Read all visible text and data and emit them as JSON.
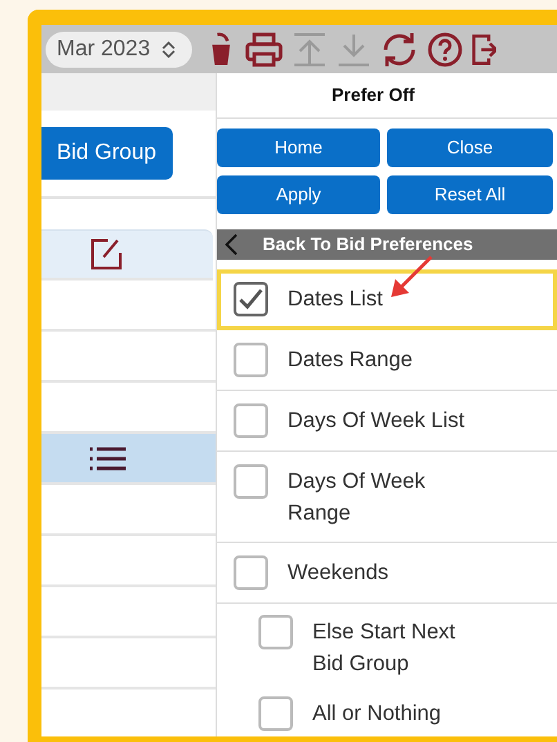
{
  "toolbar": {
    "period": "Mar 2023",
    "icons": [
      {
        "kind": "trash",
        "disabled": false
      },
      {
        "kind": "print",
        "disabled": false
      },
      {
        "kind": "upload",
        "disabled": true
      },
      {
        "kind": "download",
        "disabled": true
      },
      {
        "kind": "refresh",
        "disabled": false
      },
      {
        "kind": "help",
        "disabled": false
      },
      {
        "kind": "logout",
        "disabled": false
      }
    ]
  },
  "left_panel": {
    "button": "Bid Group",
    "rows": [
      {
        "kind": "edit",
        "selected": false
      },
      {
        "kind": "empty",
        "selected": false
      },
      {
        "kind": "empty",
        "selected": false
      },
      {
        "kind": "empty",
        "selected": false
      },
      {
        "kind": "list",
        "selected": true
      },
      {
        "kind": "empty",
        "selected": false
      },
      {
        "kind": "empty",
        "selected": false
      },
      {
        "kind": "empty",
        "selected": false
      },
      {
        "kind": "empty",
        "selected": false
      }
    ]
  },
  "right_panel": {
    "title": "Prefer Off",
    "buttons": [
      "Home",
      "Close",
      "Apply",
      "Reset All"
    ],
    "back": "Back To Bid Preferences",
    "options": [
      {
        "kind": "option",
        "label": "Dates List",
        "checked": true,
        "highlighted": true
      },
      {
        "kind": "option",
        "label": "Dates Range",
        "checked": false,
        "highlighted": false
      },
      {
        "kind": "option",
        "label": "Days Of Week List",
        "checked": false,
        "highlighted": false
      },
      {
        "kind": "option",
        "label": "Days Of Week Range",
        "checked": false,
        "highlighted": false
      },
      {
        "kind": "option",
        "label": "Weekends",
        "checked": false,
        "highlighted": false
      },
      {
        "kind": "sub",
        "label": "Else Start Next Bid Group",
        "checked": false,
        "highlighted": false
      },
      {
        "kind": "sub",
        "label": "All or Nothing",
        "checked": false,
        "highlighted": false
      }
    ]
  }
}
